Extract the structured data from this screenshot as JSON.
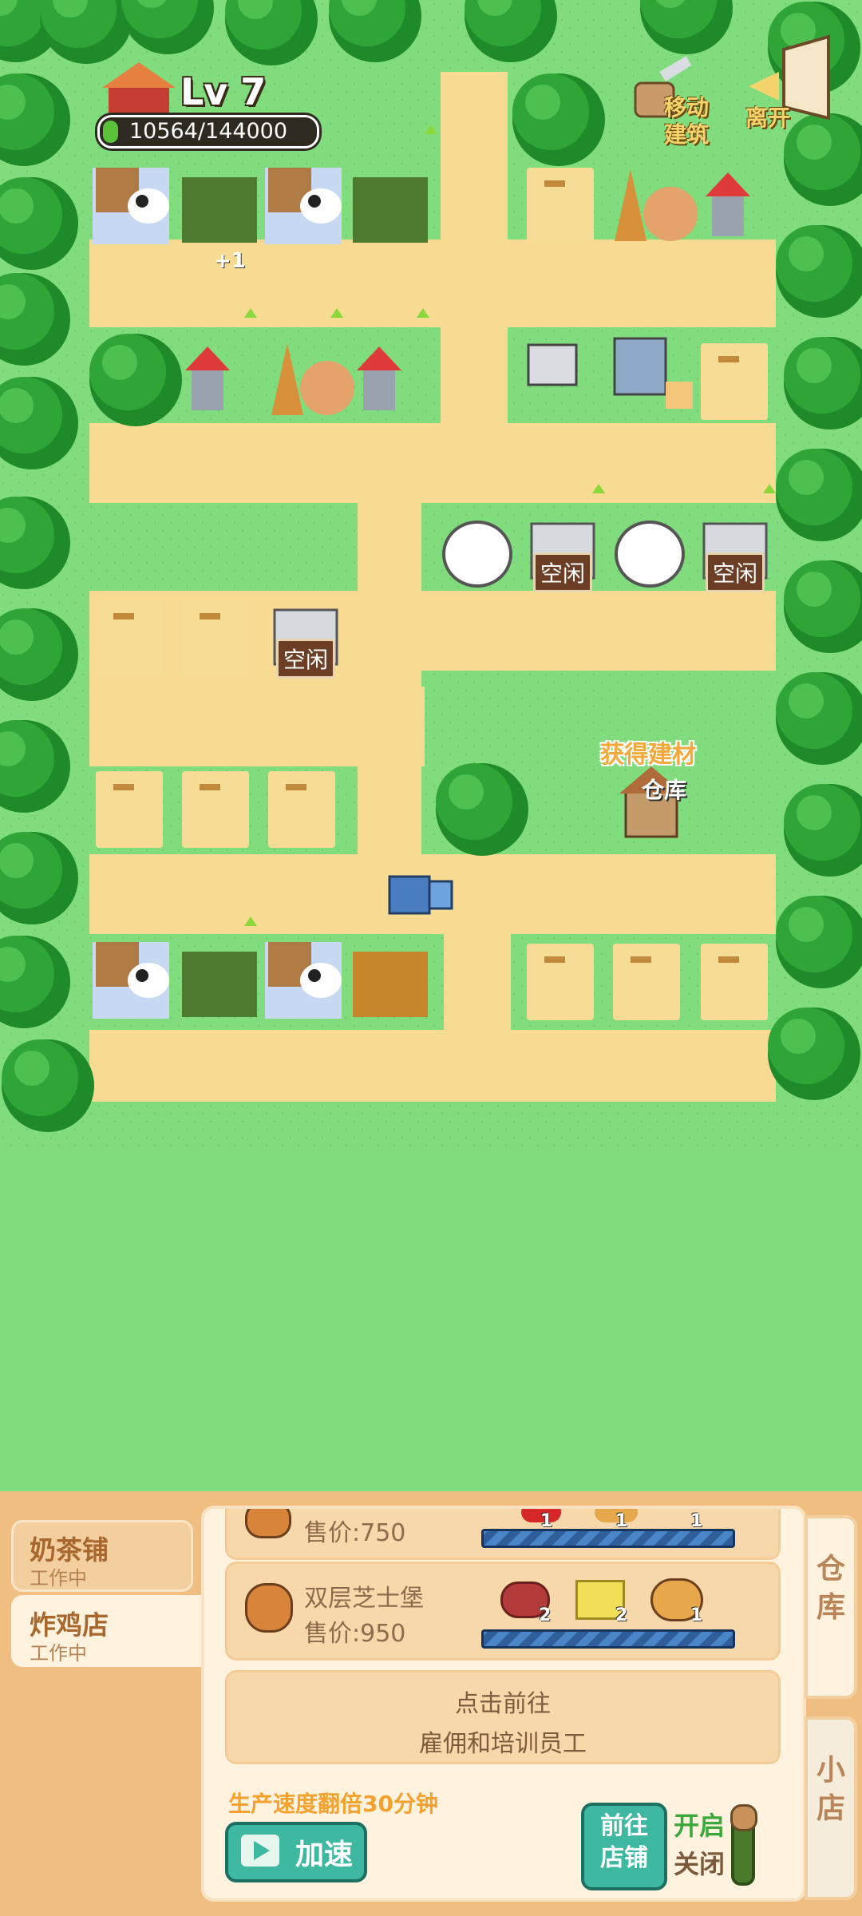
{
  "hud": {
    "level": "Lv 7",
    "xp_text": "10564/144000",
    "xp_fraction": 0.0734,
    "move_building_label": "移动\n建筑",
    "leave_label": "离开"
  },
  "map": {
    "plus_one": "+1",
    "idle_label": "空闲",
    "gain_material_label": "获得建材",
    "warehouse_label": "仓库"
  },
  "panel": {
    "shops": [
      {
        "name": "奶茶铺",
        "status": "工作中"
      },
      {
        "name": "炸鸡店",
        "status": "工作中"
      }
    ],
    "recipes": [
      {
        "name": "",
        "price": "售价:750",
        "counts": [
          "1",
          "1",
          "1"
        ]
      },
      {
        "name": "双层芝士堡",
        "price": "售价:950",
        "counts": [
          "2",
          "2",
          "1"
        ]
      }
    ],
    "hire_line1": "点击前往",
    "hire_line2": "雇佣和培训员工",
    "speed_note": "生产速度翻倍30分钟",
    "speed_button": "加速",
    "go_shop_line1": "前往",
    "go_shop_line2": "店铺",
    "toggle_on": "开启",
    "toggle_off": "关闭",
    "side_warehouse": "仓\n库",
    "side_shop": "小\n店"
  }
}
